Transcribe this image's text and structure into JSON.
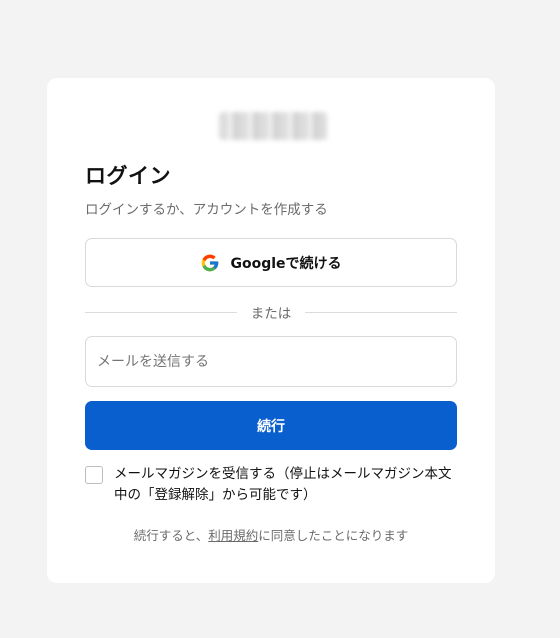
{
  "login": {
    "title": "ログイン",
    "subtitle": "ログインするか、アカウントを作成する",
    "google_button_label": "Googleで続ける",
    "divider_text": "または",
    "email_placeholder": "メールを送信する",
    "email_value": "",
    "continue_button_label": "続行",
    "newsletter_label": "メールマガジンを受信する（停止はメールマガジン本文中の「登録解除」から可能です）",
    "newsletter_checked": false,
    "terms_prefix": "続行すると、",
    "terms_link": "利用規約",
    "terms_suffix": "に同意したことになります"
  },
  "icons": {
    "google": "google-g-icon",
    "logo": "brand-logo-blurred"
  },
  "colors": {
    "page_background": "#f3f3f3",
    "card_background": "#ffffff",
    "primary_button": "#0a5fcf",
    "muted_text": "#6b6b6b",
    "border": "#d9d9d9"
  }
}
